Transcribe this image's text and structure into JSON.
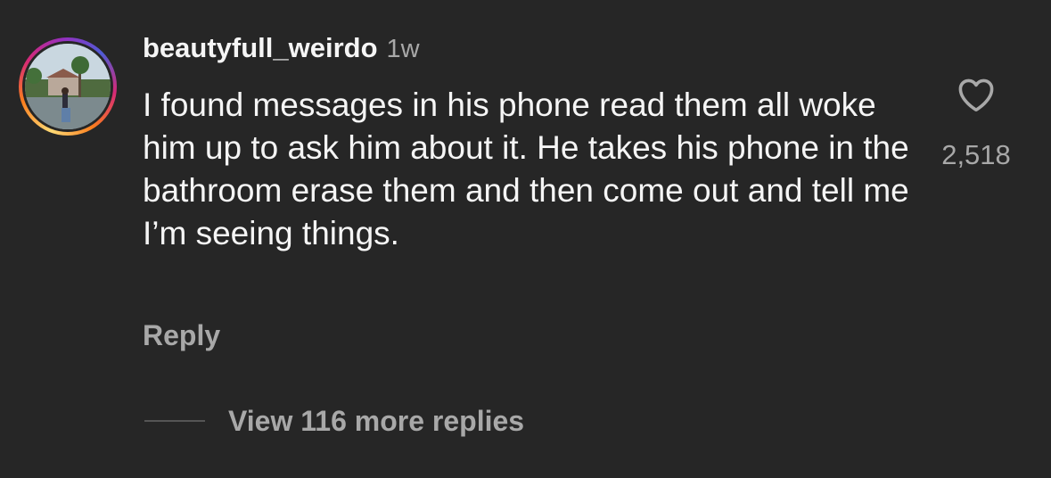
{
  "comment": {
    "username": "beautyfull_weirdo",
    "time_ago": "1w",
    "text": "I found messages in his phone read them all woke him up to ask him about it. He takes his phone in the bathroom erase them and then come out and tell me I’m seeing things.",
    "reply_label": "Reply",
    "like_icon": "heart-outline-icon",
    "like_count": "2,518",
    "view_replies_label": "View 116 more replies"
  },
  "colors": {
    "background": "#262626",
    "primary_text": "#f5f5f5",
    "secondary_text": "#a8a8a8",
    "divider": "#555555"
  }
}
